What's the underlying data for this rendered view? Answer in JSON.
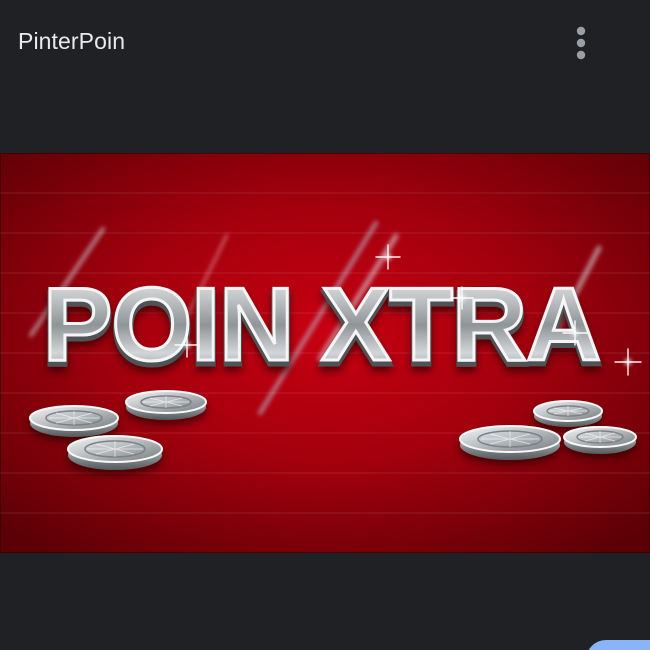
{
  "header": {
    "title": "PinterPoin",
    "menu_icon": "more-vert-icon"
  },
  "banner": {
    "text": "POIN XTRA"
  },
  "colors": {
    "background": "#202124",
    "banner_red": "#b3000c",
    "banner_dark": "#3d0004",
    "text_light": "#e8eaed",
    "accent_blue": "#8ab4f8"
  }
}
